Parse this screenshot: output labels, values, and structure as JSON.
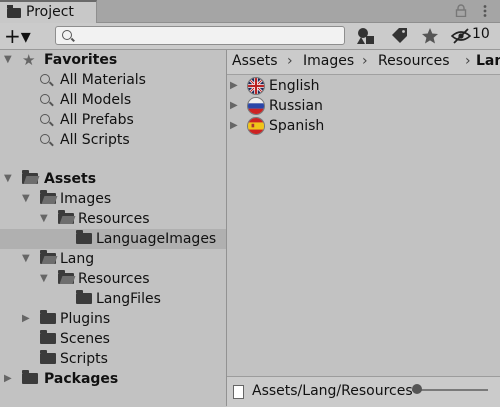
{
  "window": {
    "tab_label": "Project"
  },
  "toolbar": {
    "add_label": "+▾",
    "search": {
      "value": "",
      "placeholder": ""
    },
    "hidden_count": "10"
  },
  "tree": {
    "favorites_label": "Favorites",
    "favorites": [
      "All Materials",
      "All Models",
      "All Prefabs",
      "All Scripts"
    ],
    "assets_label": "Assets",
    "images_label": "Images",
    "images_resources_label": "Resources",
    "language_images_label": "LanguageImages",
    "lang_label": "Lang",
    "lang_resources_label": "Resources",
    "lang_files_label": "LangFiles",
    "plugins_label": "Plugins",
    "scenes_label": "Scenes",
    "scripts_label": "Scripts",
    "packages_label": "Packages"
  },
  "breadcrumb": [
    "Assets",
    "Images",
    "Resources",
    "Lan"
  ],
  "assets": [
    {
      "label": "English",
      "icon": "uk-flag-icon"
    },
    {
      "label": "Russian",
      "icon": "russia-flag-icon"
    },
    {
      "label": "Spanish",
      "icon": "spain-flag-icon"
    }
  ],
  "status": {
    "path": "Assets/Lang/Resources/LangFiles",
    "zoom_level": 0
  },
  "colors": {
    "panel_bg": "#c2c2c2",
    "selection_bg": "#b0b0b0",
    "folder_icon": "#3b3b3b"
  }
}
